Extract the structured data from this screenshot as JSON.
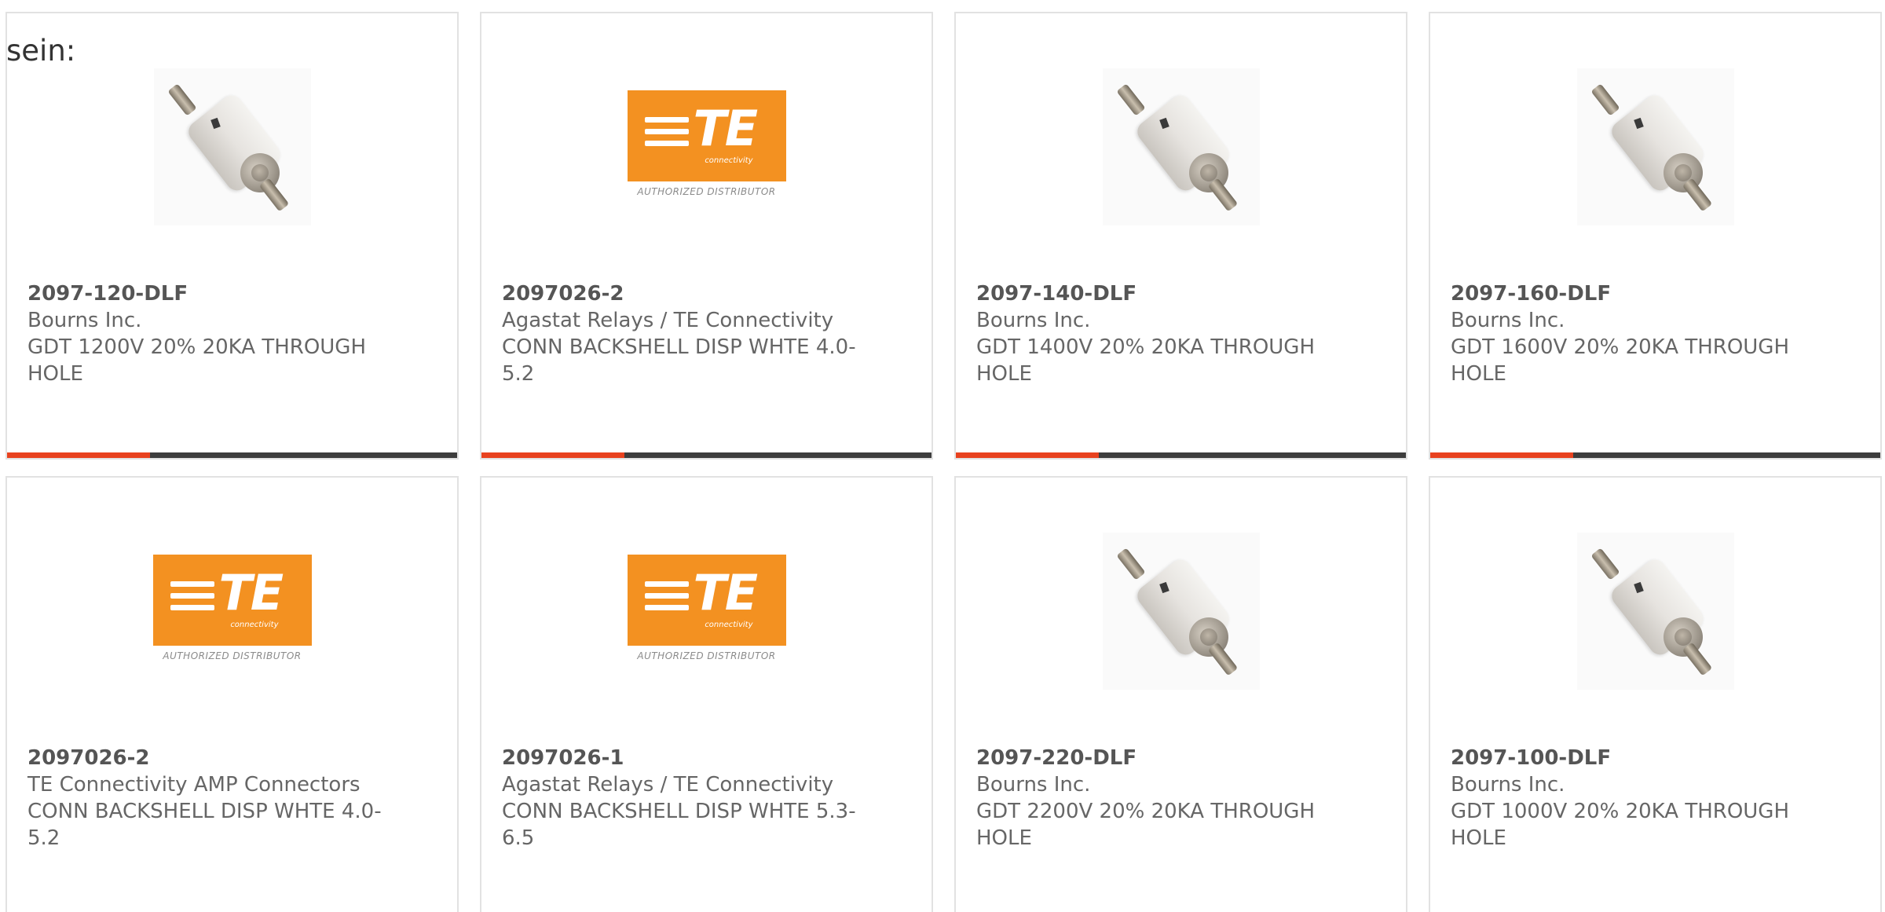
{
  "intro_text": "sein:",
  "cards": [
    {
      "part_number": "2097-120-DLF",
      "manufacturer": "Bourns Inc.",
      "description": "GDT 1200V 20% 20KA THROUGH HOLE",
      "image": "gdt-component"
    },
    {
      "part_number": "2097026-2",
      "manufacturer": "Agastat Relays / TE Connectivity",
      "description": "CONN BACKSHELL DISP WHTE 4.0-5.2",
      "image": "te-connectivity-logo"
    },
    {
      "part_number": "2097-140-DLF",
      "manufacturer": "Bourns Inc.",
      "description": "GDT 1400V 20% 20KA THROUGH HOLE",
      "image": "gdt-component"
    },
    {
      "part_number": "2097-160-DLF",
      "manufacturer": "Bourns Inc.",
      "description": "GDT 1600V 20% 20KA THROUGH HOLE",
      "image": "gdt-component"
    },
    {
      "part_number": "2097026-2",
      "manufacturer": "TE Connectivity AMP Connectors",
      "description": "CONN BACKSHELL DISP WHTE 4.0-5.2",
      "image": "te-connectivity-logo"
    },
    {
      "part_number": "2097026-1",
      "manufacturer": "Agastat Relays / TE Connectivity",
      "description": "CONN BACKSHELL DISP WHTE 5.3-6.5",
      "image": "te-connectivity-logo"
    },
    {
      "part_number": "2097-220-DLF",
      "manufacturer": "Bourns Inc.",
      "description": "GDT 2200V 20% 20KA THROUGH HOLE",
      "image": "gdt-component"
    },
    {
      "part_number": "2097-100-DLF",
      "manufacturer": "Bourns Inc.",
      "description": "GDT 1000V 20% 20KA THROUGH HOLE",
      "image": "gdt-component"
    }
  ],
  "te_logo": {
    "wordmark": "TE",
    "subtitle": "connectivity",
    "tagline": "AUTHORIZED DISTRIBUTOR"
  },
  "colors": {
    "accent_bar": "#e8421f",
    "bar_track": "#3d3d3d",
    "te_orange": "#f39121",
    "text": "#666666"
  }
}
